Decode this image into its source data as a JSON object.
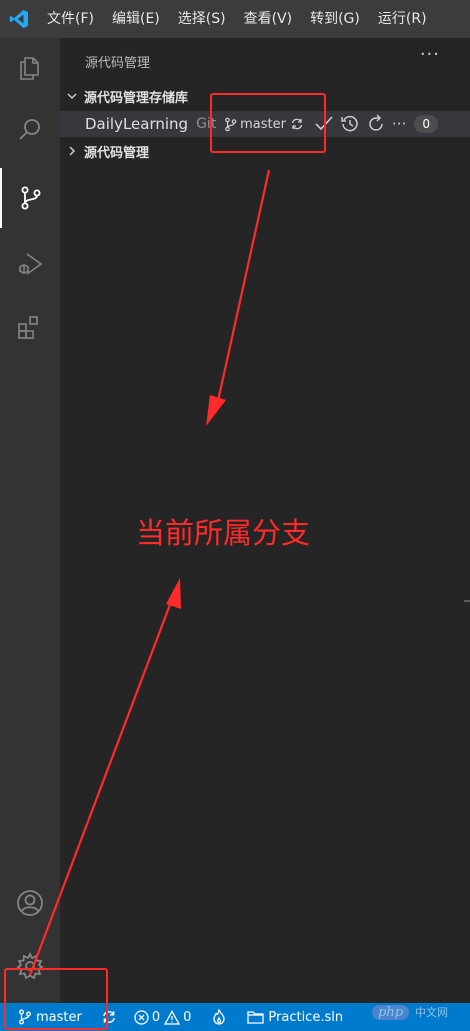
{
  "menubar": {
    "items": [
      "文件(F)",
      "编辑(E)",
      "选择(S)",
      "查看(V)",
      "转到(G)",
      "运行(R)"
    ]
  },
  "activitybar": {
    "icons": [
      "files-icon",
      "search-icon",
      "source-control-icon",
      "run-debug-icon",
      "extensions-icon",
      "account-icon",
      "settings-gear-icon"
    ]
  },
  "sidebar": {
    "title": "源代码管理",
    "more": "···",
    "repos_header": "源代码管理存储库",
    "repo": {
      "name": "DailyLearning",
      "provider": "Git",
      "branch": "master",
      "badge": "0"
    },
    "scm_header": "源代码管理"
  },
  "annotation": {
    "text": "当前所属分支"
  },
  "statusbar": {
    "branch": "master",
    "errors": "0",
    "warnings": "0",
    "solution": "Practice.sln"
  },
  "watermark": {
    "logo": "php",
    "site": "中文网"
  },
  "colors": {
    "accent": "#007acc",
    "annotation": "#ff2a2a",
    "activitybar": "#333333",
    "sidebar": "#252526"
  }
}
